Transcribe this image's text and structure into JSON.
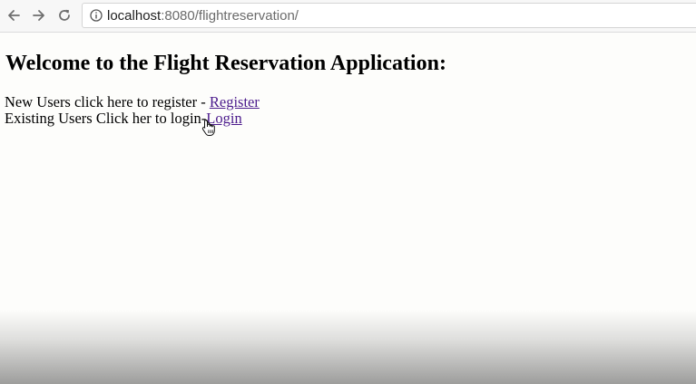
{
  "browser": {
    "back_icon": "arrow-left-icon",
    "forward_icon": "arrow-right-icon",
    "reload_icon": "reload-icon",
    "info_icon": "info-icon",
    "url_host": "localhost",
    "url_rest": ":8080/flightreservation/"
  },
  "page": {
    "title": "Welcome to the Flight Reservation Application:",
    "register_prefix": "New Users click here to register - ",
    "register_link": "Register",
    "login_prefix": "Existing Users Click her to login-",
    "login_link": "Login"
  },
  "colors": {
    "link_visited": "#4b1a8c",
    "background": "#fdfdfb"
  }
}
